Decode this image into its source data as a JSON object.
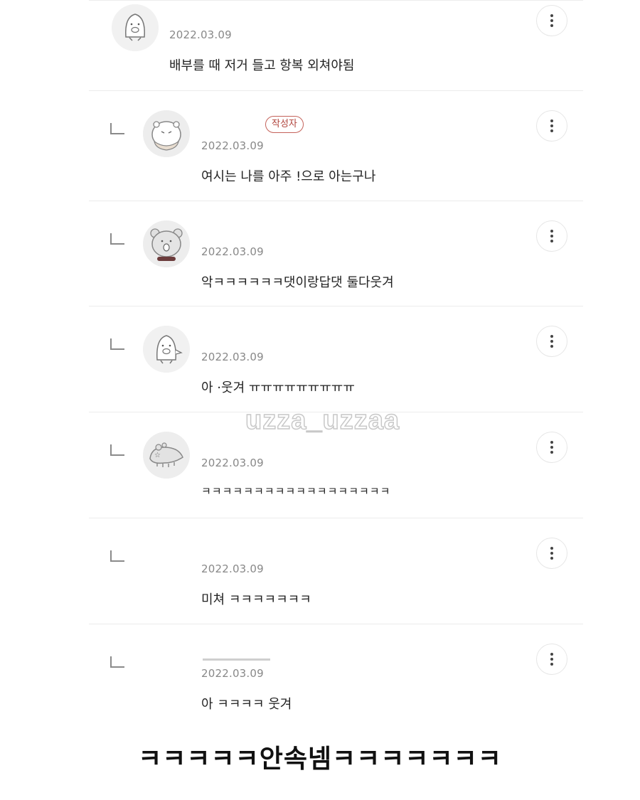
{
  "comments": [
    {
      "date": "2022.03.09",
      "text": "배부를 때 저거 들고 항복 외쳐야됨",
      "avatar_icon": "penguin-avatar"
    },
    {
      "date": "2022.03.09",
      "text": "여시는 나를 아주      !으로 아는구나",
      "author_badge": "작성자",
      "avatar_icon": "hamster-avatar"
    },
    {
      "date": "2022.03.09",
      "text": "악ㅋㅋㅋㅋㅋㅋ댓이랑답댓 둘다웃겨",
      "avatar_icon": "bear-avatar"
    },
    {
      "date": "2022.03.09",
      "text": "아       ·웃겨 ㅠㅠㅠㅠㅠㅠㅠㅠㅠ",
      "avatar_icon": "penguin-avatar"
    },
    {
      "date": "2022.03.09",
      "text": "ㅋㅋㅋㅋㅋㅋㅋㅋㅋㅋㅋㅋㅋㅋㅋㅋㅋㅋ",
      "avatar_icon": "crocodile-avatar"
    },
    {
      "date": "2022.03.09",
      "text": "미쳐 ㅋㅋㅋㅋㅋㅋㅋ"
    },
    {
      "date": "2022.03.09",
      "text": "아 ㅋㅋㅋㅋ 웃겨"
    }
  ],
  "watermark": "uzza_uzzaa",
  "caption": "ㅋㅋㅋㅋㅋ안속넴ㅋㅋㅋㅋㅋㅋㅋ"
}
